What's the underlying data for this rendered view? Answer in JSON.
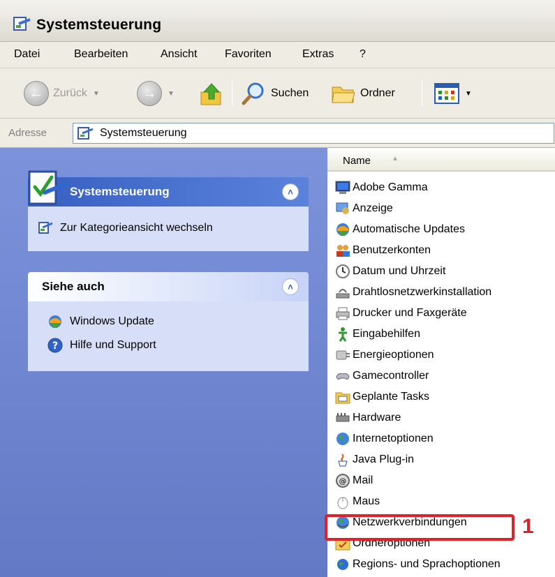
{
  "window": {
    "title": "Systemsteuerung"
  },
  "menu": [
    "Datei",
    "Bearbeiten",
    "Ansicht",
    "Favoriten",
    "Extras",
    "?"
  ],
  "toolbar": {
    "back": "Zurück",
    "search": "Suchen",
    "folders": "Ordner"
  },
  "address": {
    "label": "Adresse",
    "value": "Systemsteuerung"
  },
  "sidebar": {
    "system_panel": {
      "title": "Systemsteuerung",
      "task": "Zur Kategorieansicht wechseln"
    },
    "see_also": {
      "title": "Siehe auch",
      "links": [
        "Windows Update",
        "Hilfe und Support"
      ]
    }
  },
  "list": {
    "column": "Name",
    "items": [
      "Adobe Gamma",
      "Anzeige",
      "Automatische Updates",
      "Benutzerkonten",
      "Datum und Uhrzeit",
      "Drahtlosnetzwerkinstallation",
      "Drucker und Faxgeräte",
      "Eingabehilfen",
      "Energieoptionen",
      "Gamecontroller",
      "Geplante Tasks",
      "Hardware",
      "Internetoptionen",
      "Java Plug-in",
      "Mail",
      "Maus",
      "Netzwerkverbindungen",
      "Ordneroptionen",
      "Regions- und Sprachoptionen"
    ]
  },
  "annotation": {
    "number": "1",
    "color": "#e0202a"
  },
  "colors": {
    "sidebar_bg": "#7c93dc",
    "panel_bg": "#d6dff7",
    "panel_header": "#375fc1",
    "link": "#215dc6"
  }
}
